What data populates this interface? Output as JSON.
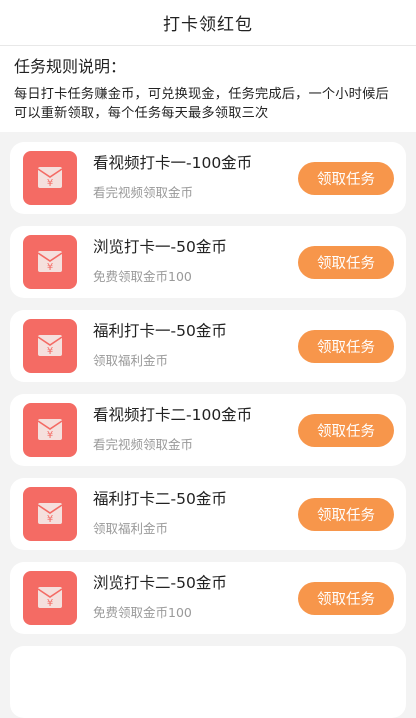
{
  "header": {
    "title": "打卡领红包"
  },
  "rules": {
    "title": "任务规则说明：",
    "body": "每日打卡任务赚金币，可兑换现金，任务完成后，一个小时候后可以重新领取，每个任务每天最多领取三次"
  },
  "colors": {
    "icon_background": "#f46b64",
    "button_background": "#f7964b",
    "card_background": "#ffffff",
    "page_background": "#f3f3f3"
  },
  "tasks": [
    {
      "icon": "red-envelope-icon",
      "title": "看视频打卡一-100金币",
      "subtitle": "看完视频领取金币",
      "button_label": "领取任务"
    },
    {
      "icon": "red-envelope-icon",
      "title": "浏览打卡一-50金币",
      "subtitle": "免费领取金币100",
      "button_label": "领取任务"
    },
    {
      "icon": "red-envelope-icon",
      "title": "福利打卡一-50金币",
      "subtitle": "领取福利金币",
      "button_label": "领取任务"
    },
    {
      "icon": "red-envelope-icon",
      "title": "看视频打卡二-100金币",
      "subtitle": "看完视频领取金币",
      "button_label": "领取任务"
    },
    {
      "icon": "red-envelope-icon",
      "title": "福利打卡二-50金币",
      "subtitle": "领取福利金币",
      "button_label": "领取任务"
    },
    {
      "icon": "red-envelope-icon",
      "title": "浏览打卡二-50金币",
      "subtitle": "免费领取金币100",
      "button_label": "领取任务"
    }
  ]
}
